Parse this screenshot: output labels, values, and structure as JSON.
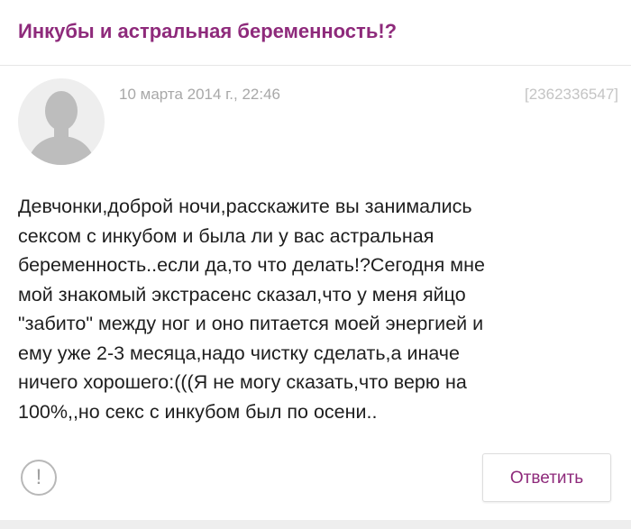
{
  "page": {
    "title": "Инкубы и астральная беременность!?"
  },
  "post": {
    "date": "10 марта 2014 г., 22:46",
    "id": "[2362336547]",
    "text_lines": [
      "Девчонки,доброй ночи,расскажите вы занимались",
      "сексом с инкубом и была ли у вас астральная",
      "беременность..если да,то что делать!?Сегодня мне",
      "мой знакомый экстрасенс сказал,что у меня яйцо",
      "\"забито\" между ног и оно питается моей энергией и",
      "ему уже 2-3 месяца,надо чистку сделать,а иначе",
      "ничего хорошего:(((Я не могу сказать,что верю на",
      "100%,,но секс с инкубом был по осени.."
    ]
  },
  "actions": {
    "report_icon": "!",
    "reply_label": "Ответить"
  },
  "colors": {
    "accent": "#8e2a7b",
    "meta_text": "#a8a8a8",
    "avatar_bg": "#eeeeee",
    "avatar_figure": "#bdbdbd"
  },
  "icons": {
    "avatar": "person-silhouette-icon",
    "report": "exclamation-circle-icon"
  }
}
